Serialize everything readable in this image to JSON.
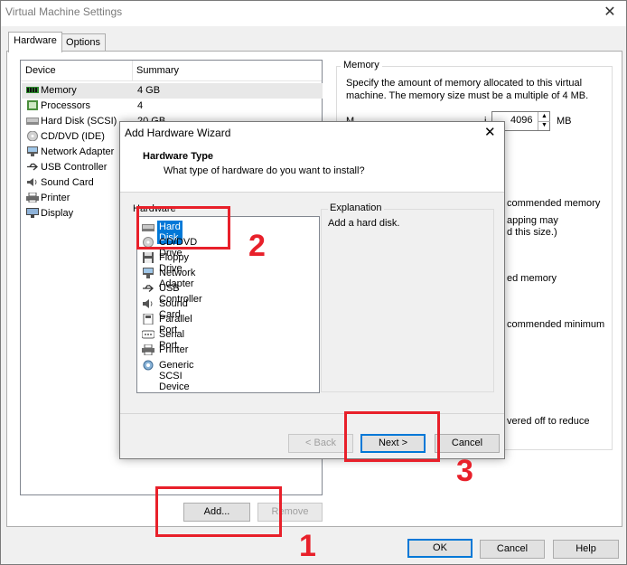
{
  "window": {
    "title": "Virtual Machine Settings"
  },
  "tabs": [
    {
      "label": "Hardware"
    },
    {
      "label": "Options"
    }
  ],
  "device_list": {
    "headers": {
      "device": "Device",
      "summary": "Summary"
    },
    "items": [
      {
        "name": "Memory",
        "summary": "4 GB",
        "icon": "memory-icon"
      },
      {
        "name": "Processors",
        "summary": "4",
        "icon": "processor-icon"
      },
      {
        "name": "Hard Disk (SCSI)",
        "summary": "20 GB",
        "icon": "hard-disk-icon"
      },
      {
        "name": "CD/DVD (IDE)",
        "summary": "",
        "icon": "cd-dvd-icon"
      },
      {
        "name": "Network Adapter",
        "summary": "",
        "icon": "network-adapter-icon"
      },
      {
        "name": "USB Controller",
        "summary": "",
        "icon": "usb-icon"
      },
      {
        "name": "Sound Card",
        "summary": "",
        "icon": "sound-card-icon"
      },
      {
        "name": "Printer",
        "summary": "",
        "icon": "printer-icon"
      },
      {
        "name": "Display",
        "summary": "",
        "icon": "display-icon"
      }
    ],
    "add_label": "Add...",
    "remove_label": "Remove"
  },
  "memory_panel": {
    "group_title": "Memory",
    "description": "Specify the amount of memory allocated to this virtual machine. The memory size must be a multiple of 4 MB.",
    "field_label_partial": "M",
    "field_label_partial_2": "i",
    "value": "4096",
    "unit": "MB",
    "notes": [
      "commended memory",
      "apping may",
      "d this size.)",
      "ed memory",
      "commended minimum",
      "vered off to reduce"
    ]
  },
  "wizard": {
    "title": "Add Hardware Wizard",
    "heading": "Hardware Type",
    "subheading": "What type of hardware do you want to install?",
    "list_label": "Hardware",
    "items": [
      {
        "name": "Hard Disk",
        "icon": "hard-disk-icon",
        "selected": true
      },
      {
        "name": "CD/DVD Drive",
        "icon": "cd-dvd-icon"
      },
      {
        "name": "Floppy Drive",
        "icon": "floppy-icon"
      },
      {
        "name": "Network Adapter",
        "icon": "network-adapter-icon"
      },
      {
        "name": "USB Controller",
        "icon": "usb-icon"
      },
      {
        "name": "Sound Card",
        "icon": "sound-card-icon"
      },
      {
        "name": "Parallel Port",
        "icon": "parallel-port-icon"
      },
      {
        "name": "Serial Port",
        "icon": "serial-port-icon"
      },
      {
        "name": "Printer",
        "icon": "printer-icon"
      },
      {
        "name": "Generic SCSI Device",
        "icon": "scsi-icon"
      }
    ],
    "explanation_title": "Explanation",
    "explanation_text": "Add a hard disk.",
    "back_label": "< Back",
    "next_label": "Next >",
    "cancel_label": "Cancel"
  },
  "footer": {
    "ok_label": "OK",
    "cancel_label": "Cancel",
    "help_label": "Help"
  },
  "annotations": [
    {
      "label": "2"
    },
    {
      "label": "3"
    },
    {
      "label": "1"
    }
  ],
  "colors": {
    "highlight": "#0078d7",
    "annotation_red": "#e8202a"
  }
}
